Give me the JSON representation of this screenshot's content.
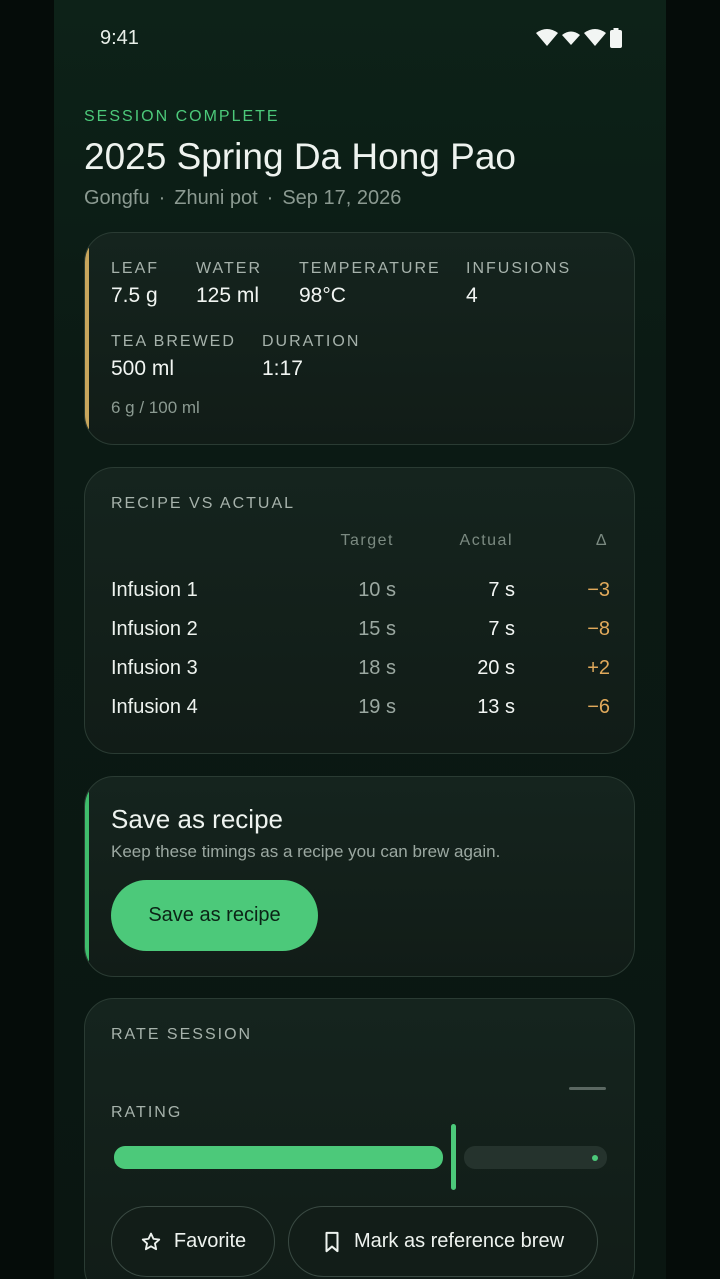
{
  "status_bar": {
    "time": "9:41",
    "icons": [
      "wifi-icon",
      "signal-icon",
      "wifi-icon",
      "battery-icon"
    ]
  },
  "header": {
    "eyebrow": "SESSION COMPLETE",
    "title": "2025 Spring Da Hong Pao",
    "meta": [
      "Gongfu",
      "Zhuni pot",
      "Sep 17, 2026"
    ],
    "meta_separator": "·"
  },
  "summary": {
    "stats": [
      {
        "label": "LEAF",
        "value": "7.5 g"
      },
      {
        "label": "WATER",
        "value": "125 ml"
      },
      {
        "label": "TEMPERATURE",
        "value": "98°C"
      },
      {
        "label": "INFUSIONS",
        "value": "4"
      },
      {
        "label": "TEA BREWED",
        "value": "500 ml"
      },
      {
        "label": "DURATION",
        "value": "1:17"
      }
    ],
    "ratio": "6 g / 100 ml"
  },
  "recipe_vs_actual": {
    "title": "RECIPE VS ACTUAL",
    "columns": {
      "target": "Target",
      "actual": "Actual",
      "delta": "Δ"
    },
    "rows": [
      {
        "name": "Infusion 1",
        "target": "10 s",
        "actual": "7 s",
        "delta": "−3"
      },
      {
        "name": "Infusion 2",
        "target": "15 s",
        "actual": "7 s",
        "delta": "−8"
      },
      {
        "name": "Infusion 3",
        "target": "18 s",
        "actual": "20 s",
        "delta": "+2"
      },
      {
        "name": "Infusion 4",
        "target": "19 s",
        "actual": "13 s",
        "delta": "−6"
      }
    ]
  },
  "save_recipe": {
    "title": "Save as recipe",
    "description": "Keep these timings as a recipe you can brew again.",
    "button_label": "Save as recipe"
  },
  "rate_session": {
    "title": "RATE SESSION",
    "rating_label": "RATING",
    "rating_fraction": 0.69,
    "favorite_label": "Favorite",
    "reference_label": "Mark as reference brew"
  },
  "colors": {
    "accent": "#4cc97a",
    "gold": "#c8a65c",
    "delta": "#e0a95b"
  }
}
